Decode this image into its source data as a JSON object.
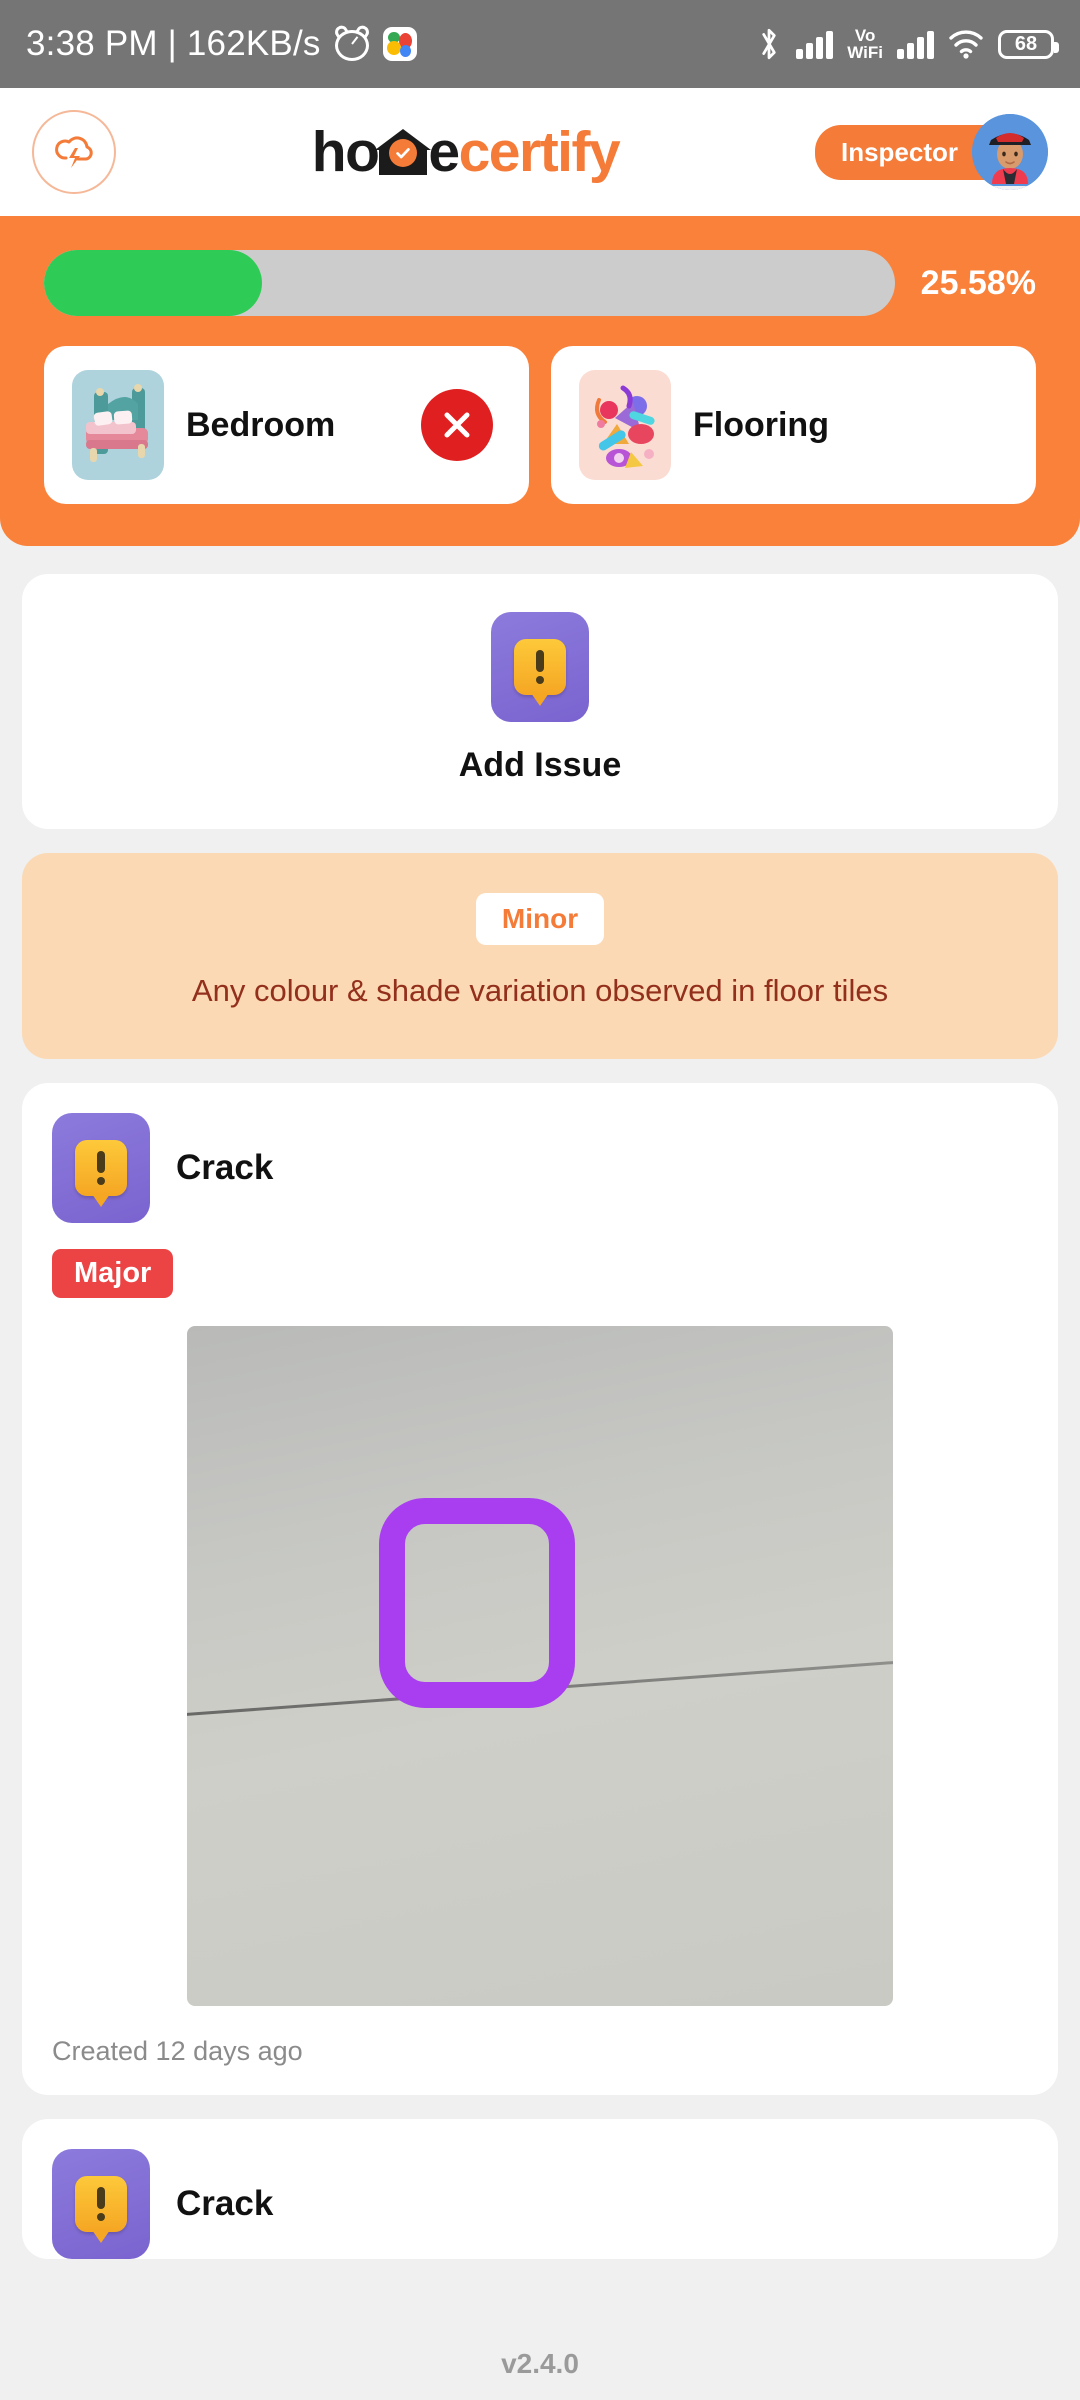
{
  "statusbar": {
    "clock": "3:38 PM | 162KB/s",
    "alarm_icon": "alarm-icon",
    "photos_icon": "google-photos-icon",
    "bluetooth_icon": "bluetooth-icon",
    "signal1_icon": "cellular-signal-icon",
    "vowifi_label_top": "Vo",
    "vowifi_label_bottom": "WiFi",
    "signal2_icon": "cellular-signal-icon",
    "wifi_icon": "wifi-icon",
    "battery_level": "68"
  },
  "header": {
    "cloud_icon": "cloud-lightning-icon",
    "logo_part1": "ho",
    "logo_house_icon": "house-check-icon",
    "logo_part2": "e",
    "logo_part3": "certify",
    "role": "Inspector",
    "avatar_icon": "firefighter-avatar"
  },
  "progress": {
    "percent_label": "25.58%",
    "percent_value": 25.58,
    "fill_color": "#2ecc56",
    "track_color": "#cccccc",
    "panel_color": "#f9813a"
  },
  "chips": [
    {
      "label": "Bedroom",
      "icon": "bed-icon",
      "removable": true,
      "remove_icon": "close-circle-icon"
    },
    {
      "label": "Flooring",
      "icon": "flooring-icon",
      "removable": false
    }
  ],
  "add_issue": {
    "label": "Add Issue",
    "icon": "issue-alert-icon"
  },
  "note": {
    "badge": "Minor",
    "badge_color": "#f47b38",
    "text": "Any colour & shade variation observed in floor tiles",
    "bg_color": "#fbd9b4",
    "text_color": "#93301c"
  },
  "issues": [
    {
      "title": "Crack",
      "icon": "issue-alert-icon",
      "severity": "Major",
      "severity_color": "#ec4344",
      "photo_alt": "floor-tile-crack-photo",
      "annotation_icon": "highlight-box",
      "annotation_color": "#a93ef0",
      "created": "Created 12 days ago"
    },
    {
      "title": "Crack",
      "icon": "issue-alert-icon"
    }
  ],
  "footer": {
    "version": "v2.4.0"
  }
}
